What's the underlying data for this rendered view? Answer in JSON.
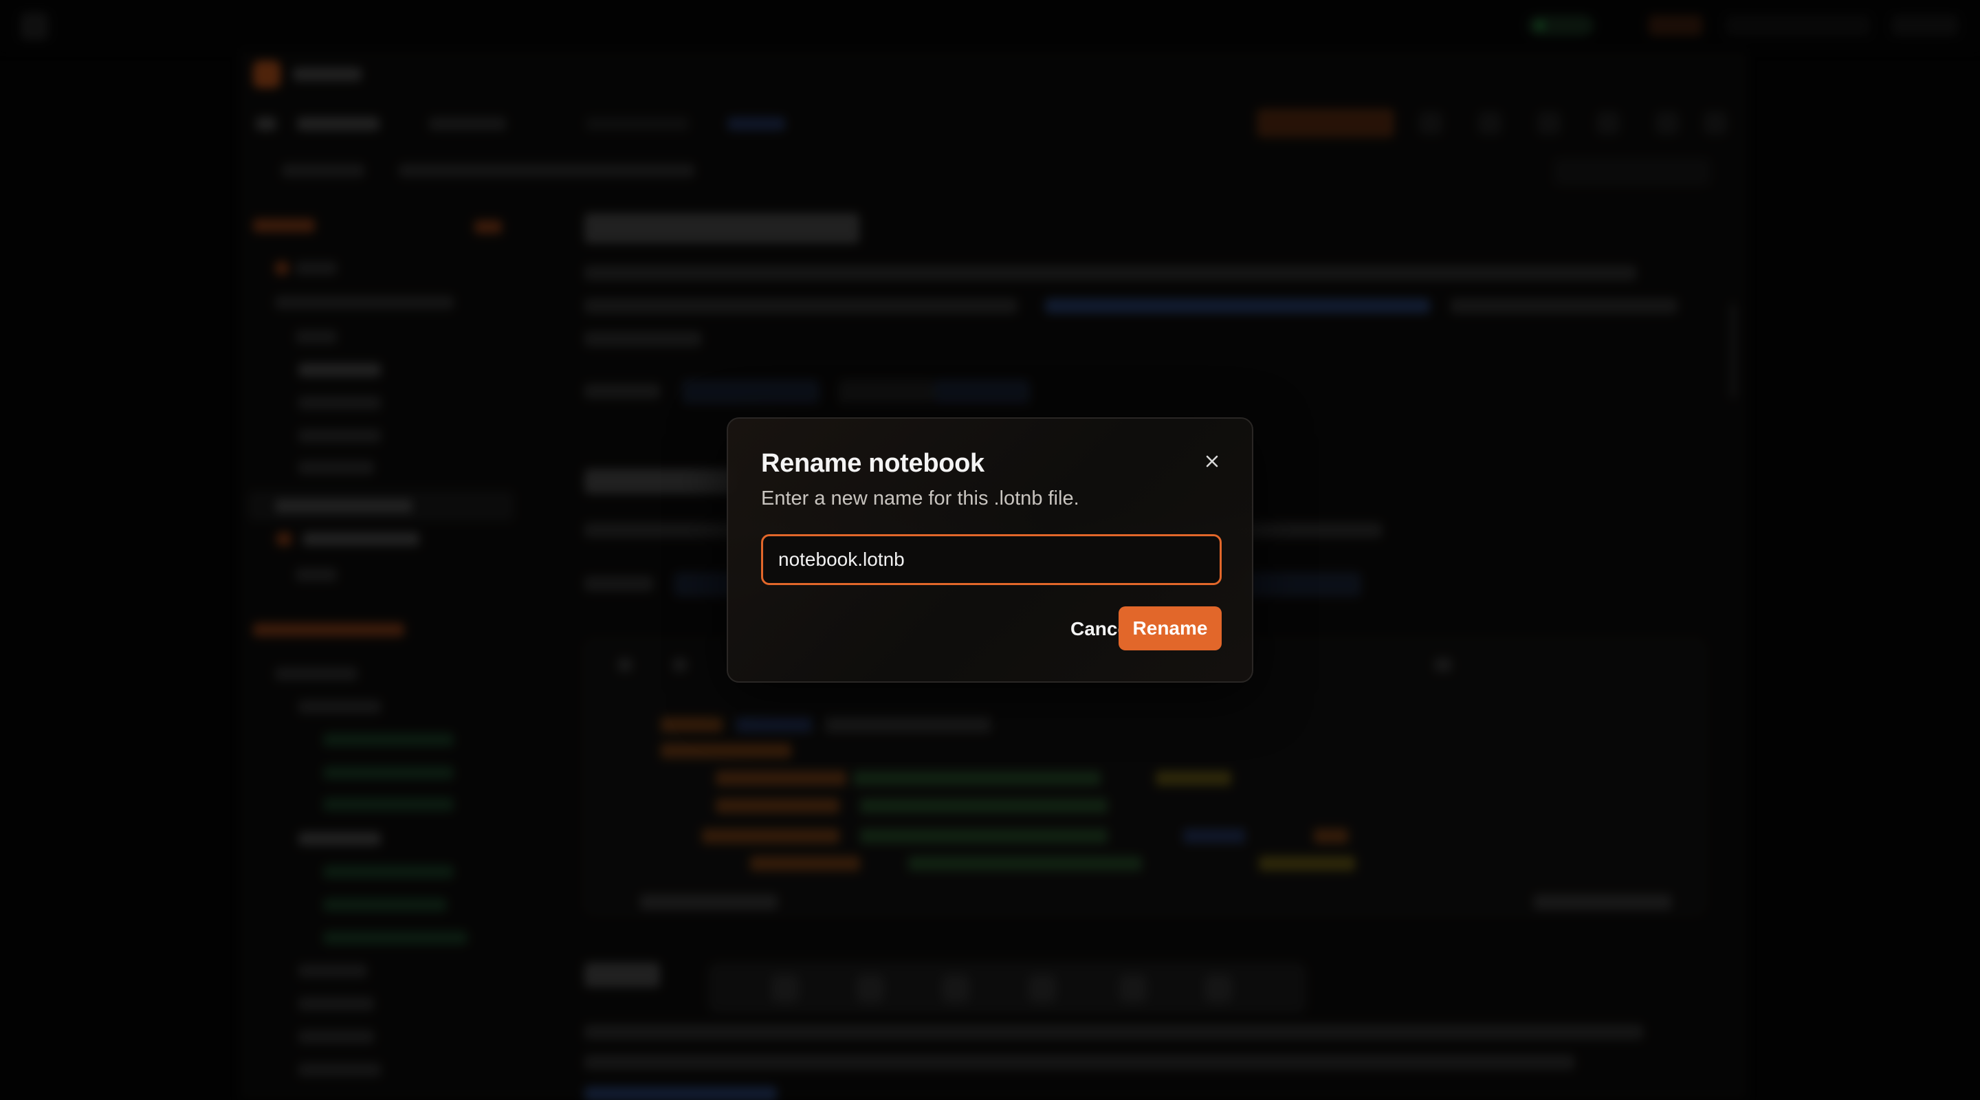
{
  "dialog": {
    "title": "Rename notebook",
    "description": "Enter a new name for this .lotnb file.",
    "input_value": "notebook.lotnb",
    "cancel_label": "Cancel",
    "confirm_label": "Rename",
    "close_icon": "close-icon",
    "accent_color": "#e2672a"
  },
  "background": {
    "blurred": true,
    "app_icon": "app-logo-icon",
    "status_color": "#2fcf55"
  }
}
